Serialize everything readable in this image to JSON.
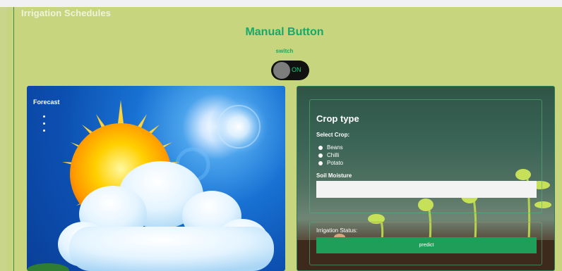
{
  "section": {
    "title": "Irrigation Schedules"
  },
  "header": {
    "title": "Manual Button",
    "switch_label": "switch",
    "toggle_state": "ON"
  },
  "forecast": {
    "title": "Forecast"
  },
  "crop": {
    "title": "Crop type",
    "select_label": "Select Crop:",
    "options": [
      "Beans",
      "Chilli",
      "Potato"
    ],
    "moisture_label": "Soil Moisture",
    "moisture_value": "",
    "status_label": "Irrigation Status:",
    "predict_label": "predict"
  },
  "colors": {
    "accent": "#18a86a",
    "panel_bg": "#c7d67e",
    "button": "#1e9e58"
  }
}
